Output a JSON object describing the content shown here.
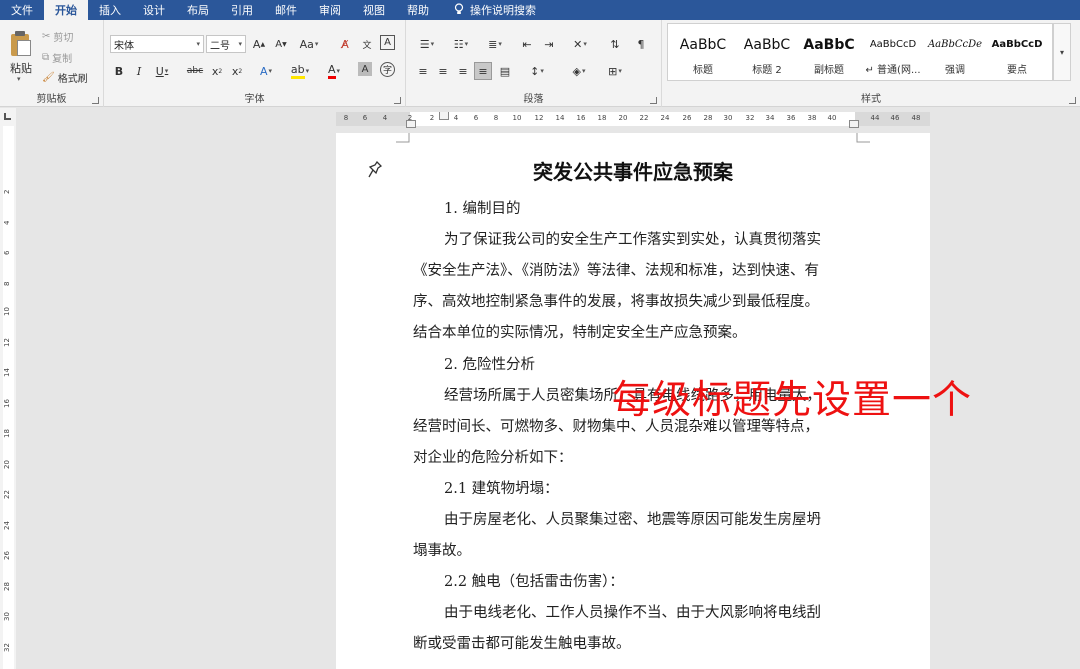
{
  "menubar": {
    "tabs": [
      "文件",
      "开始",
      "插入",
      "设计",
      "布局",
      "引用",
      "邮件",
      "审阅",
      "视图",
      "帮助"
    ],
    "active_tab": "开始",
    "search_label": "操作说明搜索"
  },
  "ribbon": {
    "clipboard": {
      "label": "剪贴板",
      "paste": "粘贴",
      "cut": "剪切",
      "copy": "复制",
      "format_painter": "格式刷"
    },
    "font": {
      "label": "字体",
      "font_name": "宋体",
      "font_size": "二号"
    },
    "paragraph": {
      "label": "段落"
    },
    "styles": {
      "label": "样式",
      "items": [
        {
          "sample": "AaBbC",
          "name": "标题"
        },
        {
          "sample": "AaBbC",
          "name": "标题 2"
        },
        {
          "sample": "AaBbC",
          "name": "副标题"
        },
        {
          "sample": "AaBbCcD",
          "name": "↵ 普通(网..."
        },
        {
          "sample": "AaBbCcDe",
          "name": "强调"
        },
        {
          "sample": "AaBbCcD",
          "name": "要点"
        }
      ]
    }
  },
  "ruler": {
    "h_ticks": [
      "8",
      "6",
      "4",
      "2",
      "2",
      "4",
      "6",
      "8",
      "10",
      "12",
      "14",
      "16",
      "18",
      "20",
      "22",
      "24",
      "26",
      "28",
      "30",
      "32",
      "34",
      "36",
      "38",
      "40",
      "44",
      "46",
      "48"
    ],
    "v_ticks": [
      "2",
      "4",
      "6",
      "8",
      "10",
      "12",
      "14",
      "16",
      "18",
      "20",
      "22",
      "24",
      "26",
      "28",
      "30",
      "32"
    ]
  },
  "document": {
    "title": "突发公共事件应急预案",
    "lines": [
      "1. 编制目的",
      "为了保证我公司的安全生产工作落实到实处，认真贯彻落实",
      "《安全生产法》、《消防法》等法律、法规和标准，达到快速、有",
      "序、高效地控制紧急事件的发展，将事故损失减少到最低程度。",
      "结合本单位的实际情况，特制定安全生产应急预案。",
      "2. 危险性分析",
      "经营场所属于人员密集场所，具有电线线路多，用电量大，",
      "经营时间长、可燃物多、财物集中、人员混杂难以管理等特点，",
      "对企业的危险分析如下：",
      "2.1 建筑物坍塌：",
      "由于房屋老化、人员聚集过密、地震等原因可能发生房屋坍",
      "塌事故。",
      "2.2 触电（包括雷击伤害）：",
      "由于电线老化、工作人员操作不当、由于大风影响将电线刮",
      "断或受雷击都可能发生触电事故。"
    ]
  },
  "overlay": {
    "text": "每级标题先设置一个",
    "color": "#ee1111"
  },
  "colors": {
    "menubar": "#2b579a",
    "ribbon": "#f3f3f3",
    "workspace": "#e6e6e6"
  }
}
